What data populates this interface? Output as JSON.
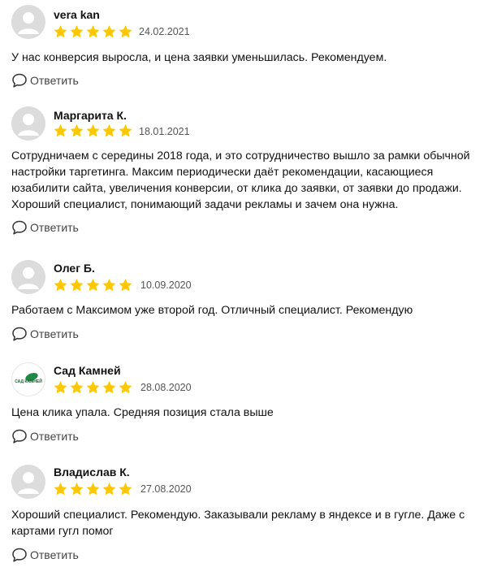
{
  "reply_label": "Ответить",
  "colors": {
    "star": "#fdc800",
    "avatar_bg": "#dcdcdc",
    "brand_green": "#1e8a43"
  },
  "reviews": [
    {
      "author": "vera kan",
      "rating": 5,
      "date": "24.02.2021",
      "text": "У нас конверсия выросла, и цена заявки уменьшилась. Рекомендуем.",
      "avatar": "default-avatar"
    },
    {
      "author": "Маргарита К.",
      "rating": 5,
      "date": "18.01.2021",
      "text": "Сотрудничаем с середины 2018 года, и это сотрудничество вышло за рамки обычной настройки таргетинга. Максим периодически даёт рекомендации, касающиеся юзабилити сайта, увеличения конверсии, от клика до заявки, от заявки до продажи. Хороший специалист, понимающий задачи рекламы и зачем она нужна.",
      "avatar": "default-avatar"
    },
    {
      "author": "Олег Б.",
      "rating": 5,
      "date": "10.09.2020",
      "text": "Работаем с Максимом уже второй год. Отличный специалист. Рекомендую",
      "avatar": "default-avatar"
    },
    {
      "author": "Сад Камней",
      "rating": 5,
      "date": "28.08.2020",
      "text": "Цена клика упала. Средняя позиция стала выше",
      "avatar": "logo",
      "logo_text": "САД КАМНЕЙ"
    },
    {
      "author": "Владислав К.",
      "rating": 5,
      "date": "27.08.2020",
      "text": "Хороший специалист. Рекомендую. Заказывали рекламу в яндексе и в гугле. Даже с картами гугл помог",
      "avatar": "default-avatar"
    }
  ]
}
